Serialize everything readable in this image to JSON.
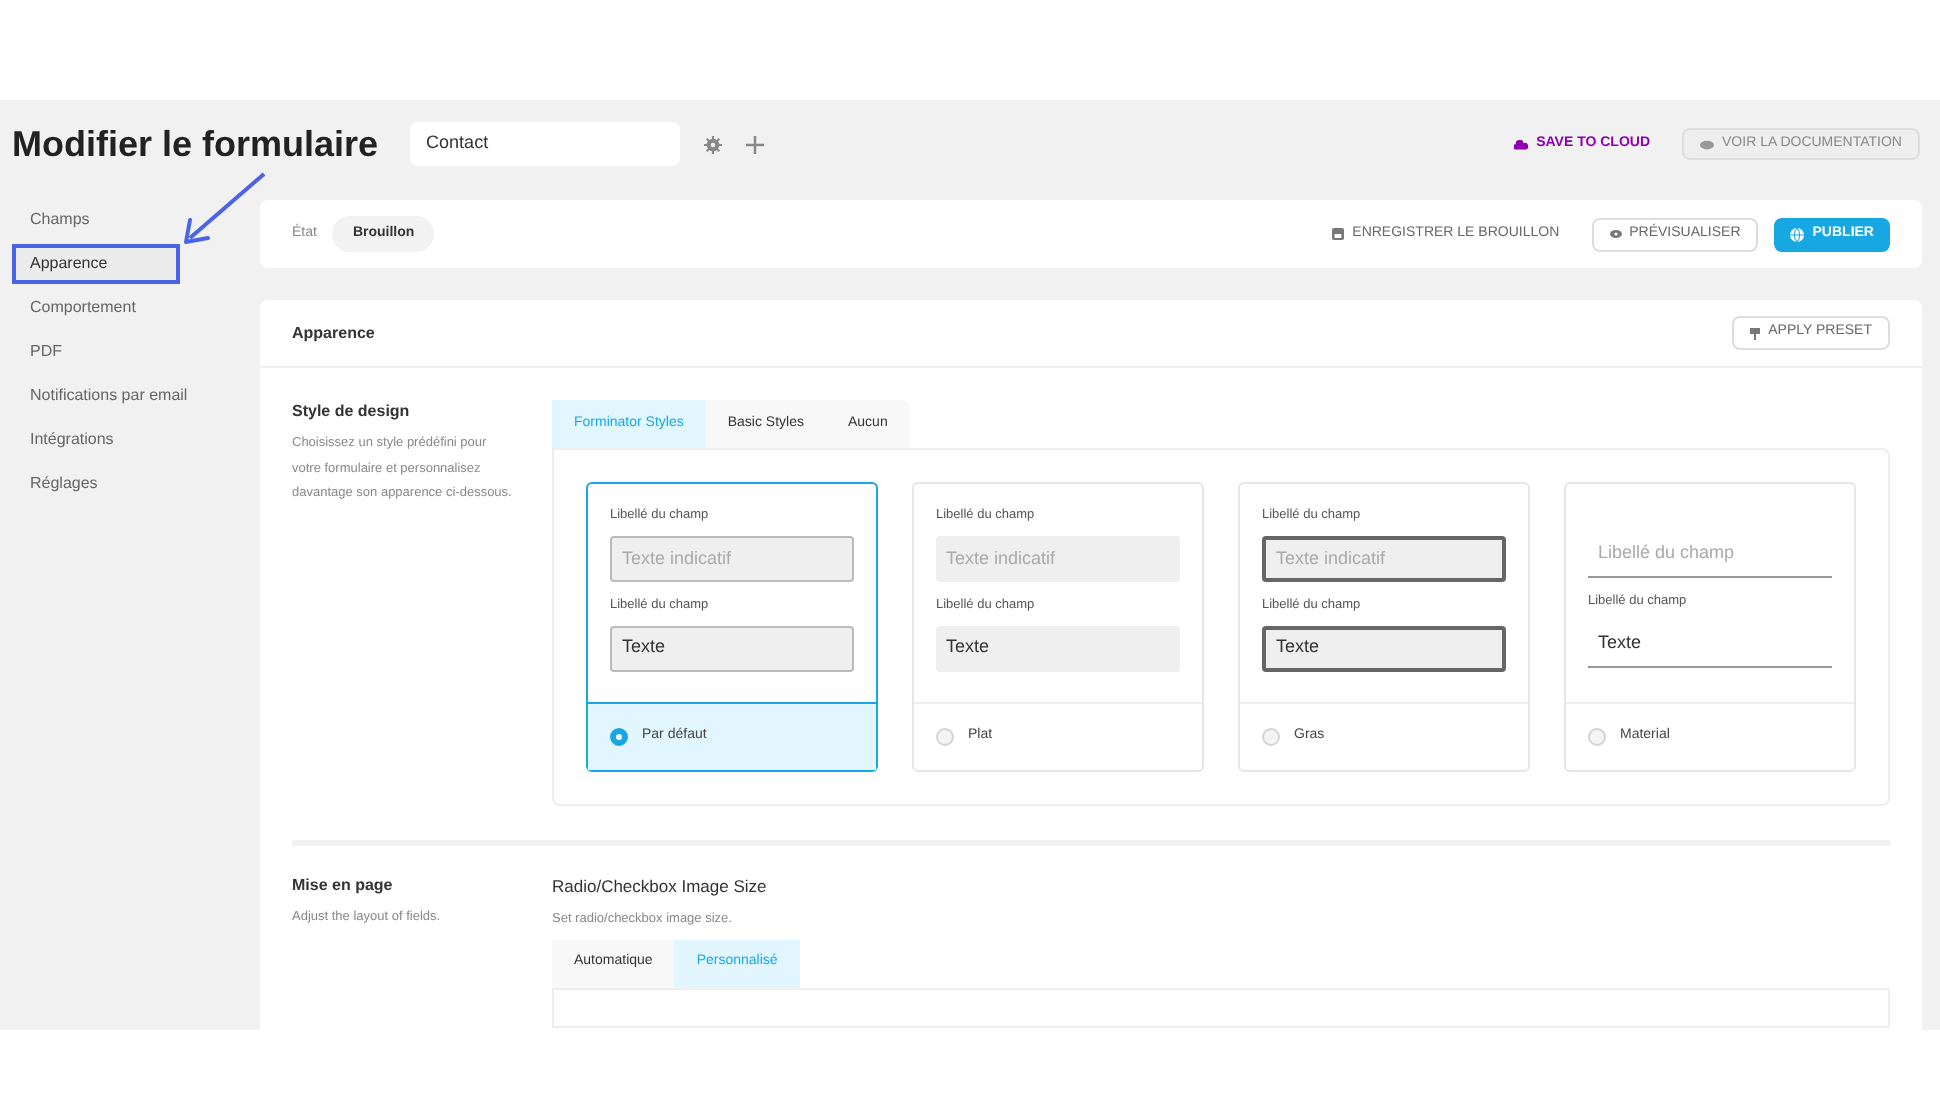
{
  "header": {
    "title": "Modifier le formulaire",
    "form_name": "Contact",
    "save_to_cloud": "SAVE TO CLOUD",
    "docs_button": "VOIR LA DOCUMENTATION"
  },
  "sidebar": {
    "items": [
      {
        "label": "Champs",
        "selected": false
      },
      {
        "label": "Apparence",
        "selected": true
      },
      {
        "label": "Comportement",
        "selected": false
      },
      {
        "label": "PDF",
        "selected": false
      },
      {
        "label": "Notifications par email",
        "selected": false
      },
      {
        "label": "Intégrations",
        "selected": false
      },
      {
        "label": "Réglages",
        "selected": false
      }
    ]
  },
  "status_bar": {
    "label": "État",
    "status": "Brouillon",
    "save_draft": "ENREGISTRER LE BROUILLON",
    "preview": "PRÉVISUALISER",
    "publish": "PUBLIER"
  },
  "panel": {
    "title": "Apparence",
    "apply_preset": "APPLY PRESET",
    "design_style": {
      "title": "Style de design",
      "description": "Choisissez un style prédéfini pour votre formulaire et personnalisez davantage son apparence ci-dessous.",
      "tabs": [
        {
          "label": "Forminator Styles",
          "selected": true
        },
        {
          "label": "Basic Styles",
          "selected": false
        },
        {
          "label": "Aucun",
          "selected": false
        }
      ],
      "styles": [
        {
          "kind": "default",
          "label_1": "Libellé du champ",
          "placeholder": "Texte indicatif",
          "label_2": "Libellé du champ",
          "value": "Texte",
          "name": "Par défaut",
          "selected": true
        },
        {
          "kind": "flat",
          "label_1": "Libellé du champ",
          "placeholder": "Texte indicatif",
          "label_2": "Libellé du champ",
          "value": "Texte",
          "name": "Plat",
          "selected": false
        },
        {
          "kind": "bold",
          "label_1": "Libellé du champ",
          "placeholder": "Texte indicatif",
          "label_2": "Libellé du champ",
          "value": "Texte",
          "name": "Gras",
          "selected": false
        },
        {
          "kind": "material",
          "placeholder": "Libellé du champ",
          "label_2": "Libellé du champ",
          "value": "Texte",
          "name": "Material",
          "selected": false
        }
      ]
    },
    "layout": {
      "title": "Mise en page",
      "description": "Adjust the layout of fields.",
      "option_title": "Radio/Checkbox Image Size",
      "option_description": "Set radio/checkbox image size.",
      "tabs": [
        {
          "label": "Automatique",
          "selected": false
        },
        {
          "label": "Personnalisé",
          "selected": true
        }
      ]
    }
  }
}
